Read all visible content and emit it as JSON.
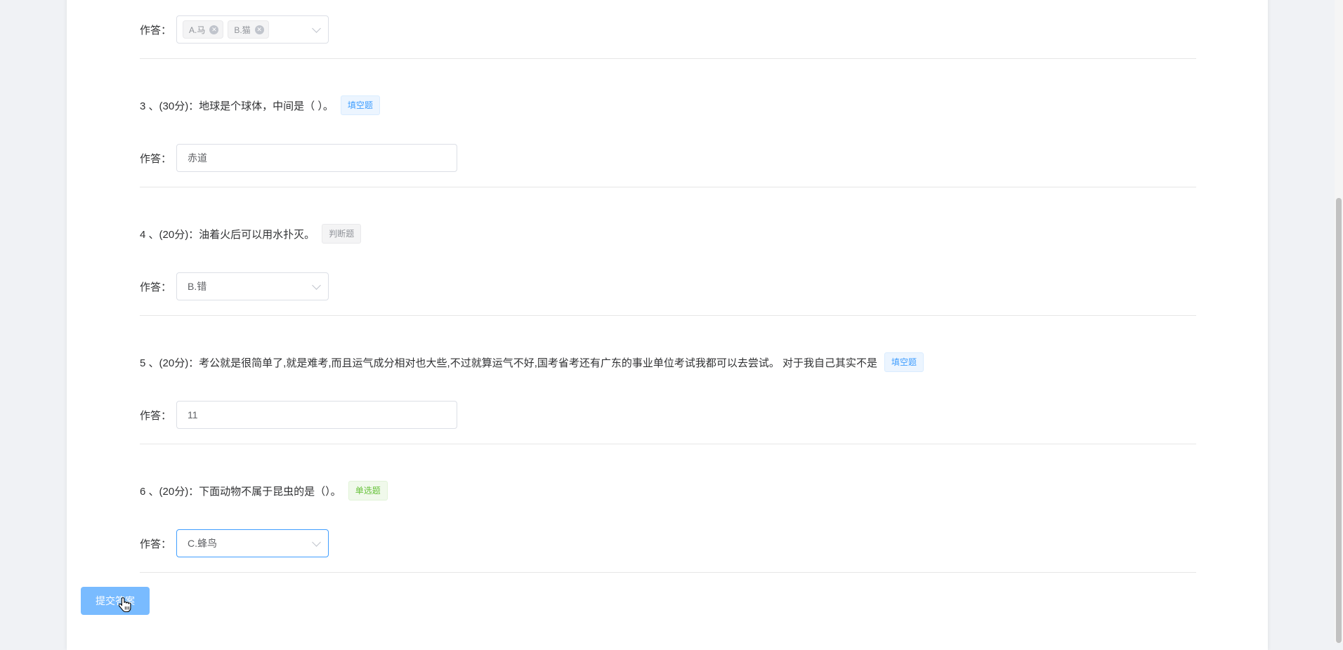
{
  "answer_label": "作答：",
  "q2": {
    "chips": [
      "A.马",
      "B.猫"
    ]
  },
  "q3": {
    "text": "3 、(30分)：地球是个球体，中间是（ ）。",
    "tag": "填空题",
    "answer": "赤道"
  },
  "q4": {
    "text": "4 、(20分)：油着火后可以用水扑灭。",
    "tag": "判断题",
    "answer": "B.错"
  },
  "q5": {
    "text": "5 、(20分)：考公就是很简单了,就是难考,而且运气成分相对也大些,不过就算运气不好,国考省考还有广东的事业单位考试我都可以去尝试。 对于我自己其实不是",
    "tag": "填空题",
    "answer": "11"
  },
  "q6": {
    "text": "6 、(20分)：下面动物不属于昆虫的是（）。",
    "tag": "单选题",
    "answer": "C.蜂鸟"
  },
  "submit_label": "提交答案",
  "icons": {
    "chip_close": "close-circle-icon",
    "select_arrow": "chevron-down-icon",
    "cursor": "hand-pointer-cursor-icon"
  },
  "colors": {
    "primary": "#409eff",
    "submit_bg": "#79bbff",
    "success": "#67c23a",
    "info": "#909399"
  }
}
